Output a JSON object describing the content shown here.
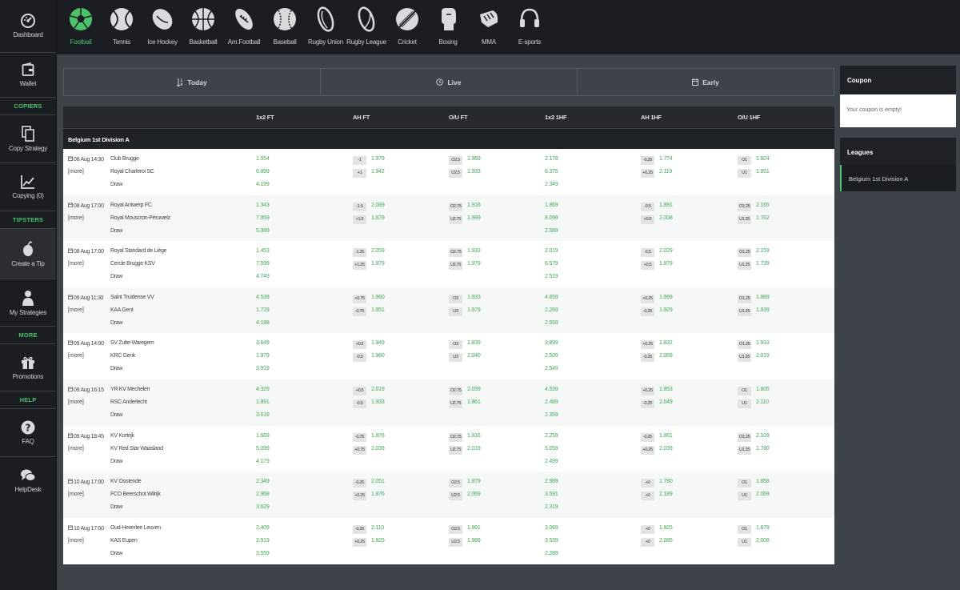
{
  "sidebar": {
    "items": [
      {
        "label": "Dashboard",
        "icon": "dashboard-icon"
      },
      {
        "label": "Wallet",
        "icon": "wallet-icon"
      },
      {
        "label": "Copy Strategy",
        "icon": "copy-icon"
      },
      {
        "label": "Copying (0)",
        "icon": "chart-line-icon"
      },
      {
        "label": "Create a Tip",
        "icon": "tip-icon"
      },
      {
        "label": "My Strategies",
        "icon": "user-icon"
      },
      {
        "label": "Promotions",
        "icon": "gift-icon"
      },
      {
        "label": "FAQ",
        "icon": "question-icon"
      },
      {
        "label": "HelpDesk",
        "icon": "chat-icon"
      }
    ],
    "sections": {
      "copiers": "COPIERS",
      "tipsters": "TIPSTERS",
      "more": "MORE",
      "help": "HELP"
    }
  },
  "sports": [
    {
      "label": "Football",
      "active": true
    },
    {
      "label": "Tennis"
    },
    {
      "label": "Ice Hockey"
    },
    {
      "label": "Basketball"
    },
    {
      "label": "Am.Football"
    },
    {
      "label": "Baseball"
    },
    {
      "label": "Rugby Union"
    },
    {
      "label": "Rugby League"
    },
    {
      "label": "Cricket"
    },
    {
      "label": "Boxing"
    },
    {
      "label": "MMA"
    },
    {
      "label": "E-sports"
    }
  ],
  "tabs": [
    {
      "label": "Today",
      "icon": "sort-icon"
    },
    {
      "label": "Live",
      "icon": "clock-icon"
    },
    {
      "label": "Early",
      "icon": "calendar-icon"
    }
  ],
  "columns": [
    "1x2 FT",
    "AH FT",
    "O/U FT",
    "1x2 1HF",
    "AH 1HF",
    "O/U 1HF"
  ],
  "league": "Belgium 1st Division A",
  "more_label": "[more]",
  "matches": [
    {
      "date": "08 Aug 14:30",
      "home": "Club Brugge",
      "away": "Royal Charleroi SC",
      "draw": "Draw",
      "x12ft": [
        "1.554",
        "6.999",
        "4.199"
      ],
      "ahft": [
        {
          "h": "-1",
          "o": "1.979"
        },
        {
          "h": "+1",
          "o": "1.942"
        }
      ],
      "ouft": [
        {
          "h": "O2.5",
          "o": "1.969"
        },
        {
          "h": "U2.5",
          "o": "1.933"
        }
      ],
      "x121hf": [
        "2.178",
        "6.375",
        "2.349"
      ],
      "ah1hf": [
        {
          "h": "-0.25",
          "o": "1.774"
        },
        {
          "h": "+0.25",
          "o": "2.119"
        }
      ],
      "ou1hf": [
        {
          "h": "O1",
          "o": "1.924"
        },
        {
          "h": "U1",
          "o": "1.951"
        }
      ]
    },
    {
      "date": "08 Aug 17:00",
      "home": "Royal Antwerp FC",
      "away": "Royal Mouscron-Péruwelz",
      "draw": "Draw",
      "x12ft": [
        "1.343",
        "7.959",
        "5.999"
      ],
      "ahft": [
        {
          "h": "-1.5",
          "o": "2.089"
        },
        {
          "h": "+1.5",
          "o": "1.879"
        }
      ],
      "ouft": [
        {
          "h": "O2.75",
          "o": "1.916"
        },
        {
          "h": "U2.75",
          "o": "1.999"
        }
      ],
      "x121hf": [
        "1.869",
        "8.099",
        "2.589"
      ],
      "ah1hf": [
        {
          "h": "-0.5",
          "o": "1.891"
        },
        {
          "h": "+0.5",
          "o": "2.008"
        }
      ],
      "ou1hf": [
        {
          "h": "O1.25",
          "o": "2.165"
        },
        {
          "h": "U1.25",
          "o": "1.762"
        }
      ]
    },
    {
      "date": "08 Aug 17:00",
      "home": "Royal Standard de Liège",
      "away": "Cercle Brugge KSV",
      "draw": "Draw",
      "x12ft": [
        "1.453",
        "7.599",
        "4.749"
      ],
      "ahft": [
        {
          "h": "-1.25",
          "o": "2.059"
        },
        {
          "h": "+1.25",
          "o": "1.879"
        }
      ],
      "ouft": [
        {
          "h": "O2.75",
          "o": "1.933"
        },
        {
          "h": "U2.75",
          "o": "1.979"
        }
      ],
      "x121hf": [
        "2.019",
        "6.579",
        "2.519"
      ],
      "ah1hf": [
        {
          "h": "-0.5",
          "o": "2.029"
        },
        {
          "h": "+0.5",
          "o": "1.879"
        }
      ],
      "ou1hf": [
        {
          "h": "O1.25",
          "o": "2.159"
        },
        {
          "h": "U1.25",
          "o": "1.739"
        }
      ]
    },
    {
      "date": "09 Aug 11:30",
      "home": "Saint Truidense VV",
      "away": "KAA Gent",
      "draw": "Draw",
      "x12ft": [
        "4.539",
        "1.729",
        "4.188"
      ],
      "ahft": [
        {
          "h": "+0.75",
          "o": "1.960"
        },
        {
          "h": "-0.75",
          "o": "1.951"
        }
      ],
      "ouft": [
        {
          "h": "O3",
          "o": "1.933"
        },
        {
          "h": "U3",
          "o": "1.979"
        }
      ],
      "x121hf": [
        "4.659",
        "2.269",
        "2.559"
      ],
      "ah1hf": [
        {
          "h": "+0.25",
          "o": "1.999"
        },
        {
          "h": "-0.25",
          "o": "1.929"
        }
      ],
      "ou1hf": [
        {
          "h": "O1.25",
          "o": "1.989"
        },
        {
          "h": "U1.25",
          "o": "1.939"
        }
      ]
    },
    {
      "date": "09 Aug 14:00",
      "home": "SV Zulte-Waregem",
      "away": "KRC Genk",
      "draw": "Draw",
      "x12ft": [
        "3.649",
        "1.979",
        "3.919"
      ],
      "ahft": [
        {
          "h": "+0.5",
          "o": "1.949"
        },
        {
          "h": "-0.5",
          "o": "1.960"
        }
      ],
      "ouft": [
        {
          "h": "O3",
          "o": "1.839"
        },
        {
          "h": "U3",
          "o": "2.040"
        }
      ],
      "x121hf": [
        "3.899",
        "2.509",
        "2.549"
      ],
      "ah1hf": [
        {
          "h": "+0.25",
          "o": "1.832"
        },
        {
          "h": "-0.25",
          "o": "2.069"
        }
      ],
      "ou1hf": [
        {
          "h": "O1.25",
          "o": "1.933"
        },
        {
          "h": "U1.25",
          "o": "2.019"
        }
      ]
    },
    {
      "date": "09 Aug 16:15",
      "home": "YR KV Mechelen",
      "away": "RSC Anderlecht",
      "draw": "Draw",
      "x12ft": [
        "4.329",
        "1.891",
        "3.619"
      ],
      "ahft": [
        {
          "h": "+0.5",
          "o": "2.019"
        },
        {
          "h": "-0.5",
          "o": "1.933"
        }
      ],
      "ouft": [
        {
          "h": "O2.75",
          "o": "2.039"
        },
        {
          "h": "U2.75",
          "o": "1.861"
        }
      ],
      "x121hf": [
        "4.539",
        "2.489",
        "2.359"
      ],
      "ah1hf": [
        {
          "h": "+0.25",
          "o": "1.853"
        },
        {
          "h": "-0.25",
          "o": "2.049"
        }
      ],
      "ou1hf": [
        {
          "h": "O1",
          "o": "1.805"
        },
        {
          "h": "U1",
          "o": "2.110"
        }
      ]
    },
    {
      "date": "09 Aug 18:45",
      "home": "KV Kortrijk",
      "away": "KV Red Star Waasland",
      "draw": "Draw",
      "x12ft": [
        "1.669",
        "5.099",
        "4.179"
      ],
      "ahft": [
        {
          "h": "-0.75",
          "o": "1.876"
        },
        {
          "h": "+0.75",
          "o": "2.039"
        }
      ],
      "ouft": [
        {
          "h": "O2.75",
          "o": "1.916"
        },
        {
          "h": "U2.75",
          "o": "2.019"
        }
      ],
      "x121hf": [
        "2.259",
        "5.059",
        "2.499"
      ],
      "ah1hf": [
        {
          "h": "-0.25",
          "o": "1.861"
        },
        {
          "h": "+0.25",
          "o": "2.039"
        }
      ],
      "ou1hf": [
        {
          "h": "O1.25",
          "o": "2.109"
        },
        {
          "h": "U1.25",
          "o": "1.780"
        }
      ]
    },
    {
      "date": "10 Aug 17:00",
      "home": "KV Oostende",
      "away": "FCO Beerschot Wilrijk",
      "draw": "Draw",
      "x12ft": [
        "2.349",
        "2.968",
        "3.629"
      ],
      "ahft": [
        {
          "h": "-0.25",
          "o": "2.051"
        },
        {
          "h": "+0.25",
          "o": "1.876"
        }
      ],
      "ouft": [
        {
          "h": "O2.5",
          "o": "1.879"
        },
        {
          "h": "U2.5",
          "o": "2.069"
        }
      ],
      "x121hf": [
        "2.989",
        "3.591",
        "2.319"
      ],
      "ah1hf": [
        {
          "h": "+0",
          "o": "1.780"
        },
        {
          "h": "+0",
          "o": "2.189"
        }
      ],
      "ou1hf": [
        {
          "h": "O1",
          "o": "1.858"
        },
        {
          "h": "U1",
          "o": "2.069"
        }
      ]
    },
    {
      "date": "10 Aug 17:00",
      "home": "Oud-Heverlee Leuven",
      "away": "KAS Eupen",
      "draw": "Draw",
      "x12ft": [
        "2.409",
        "2.919",
        "3.559"
      ],
      "ahft": [
        {
          "h": "-0.25",
          "o": "2.110"
        },
        {
          "h": "+0.25",
          "o": "1.825"
        }
      ],
      "ouft": [
        {
          "h": "O2.5",
          "o": "1.891"
        },
        {
          "h": "U2.5",
          "o": "1.989"
        }
      ],
      "x121hf": [
        "3.069",
        "3.539",
        "2.289"
      ],
      "ah1hf": [
        {
          "h": "+0",
          "o": "1.825"
        },
        {
          "h": "+0",
          "o": "2.085"
        }
      ],
      "ou1hf": [
        {
          "h": "O1",
          "o": "1.879"
        },
        {
          "h": "U1",
          "o": "2.008"
        }
      ]
    }
  ],
  "coupon": {
    "title": "Coupon",
    "empty_text": "Your coupon is empty!"
  },
  "leagues": {
    "title": "Leagues",
    "items": [
      "Belgium 1st Division A"
    ]
  },
  "colors": {
    "accent": "#4cc36b",
    "odd": "#41a95a",
    "sidebar_bg": "#1a1d21",
    "page_bg": "#3e4249"
  }
}
